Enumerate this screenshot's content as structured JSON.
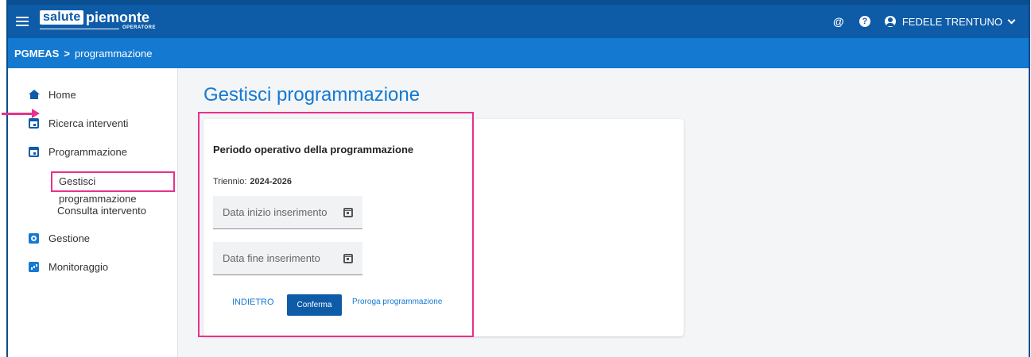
{
  "header": {
    "logo_brand": "salute",
    "logo_region": "piemonte",
    "logo_sub": "OPERATORE",
    "user_name": "FEDELE TRENTUNO",
    "icons": [
      "menu-icon",
      "at-icon",
      "help-icon",
      "user-icon",
      "chevron-down-icon"
    ]
  },
  "breadcrumb": {
    "root": "PGMEAS",
    "separator": ">",
    "current": "programmazione"
  },
  "sidebar": {
    "items": [
      {
        "label": "Home",
        "icon": "home-icon"
      },
      {
        "label": "Ricerca interventi",
        "icon": "calendar-icon"
      },
      {
        "label": "Programmazione",
        "icon": "calendar-icon"
      },
      {
        "label": "Gestisci programmazione"
      },
      {
        "label": "Consulta intervento"
      },
      {
        "label": "Gestione",
        "icon": "gear-icon"
      },
      {
        "label": "Monitoraggio",
        "icon": "chart-icon"
      }
    ]
  },
  "main": {
    "title": "Gestisci programmazione",
    "section_title": "Periodo operativo della programmazione",
    "triennio_label": "Triennio:",
    "triennio_value": "2024-2026",
    "field_start_placeholder": "Data inizio inserimento",
    "field_end_placeholder": "Data fine inserimento",
    "back_label": "INDIETRO",
    "confirm_label": "Conferma",
    "extend_label": "Proroga programmazione"
  },
  "colors": {
    "header": "#0e5ba8",
    "breadcrumb_bar": "#1479d1",
    "accent": "#1479d1",
    "highlight": "#e8318c"
  }
}
